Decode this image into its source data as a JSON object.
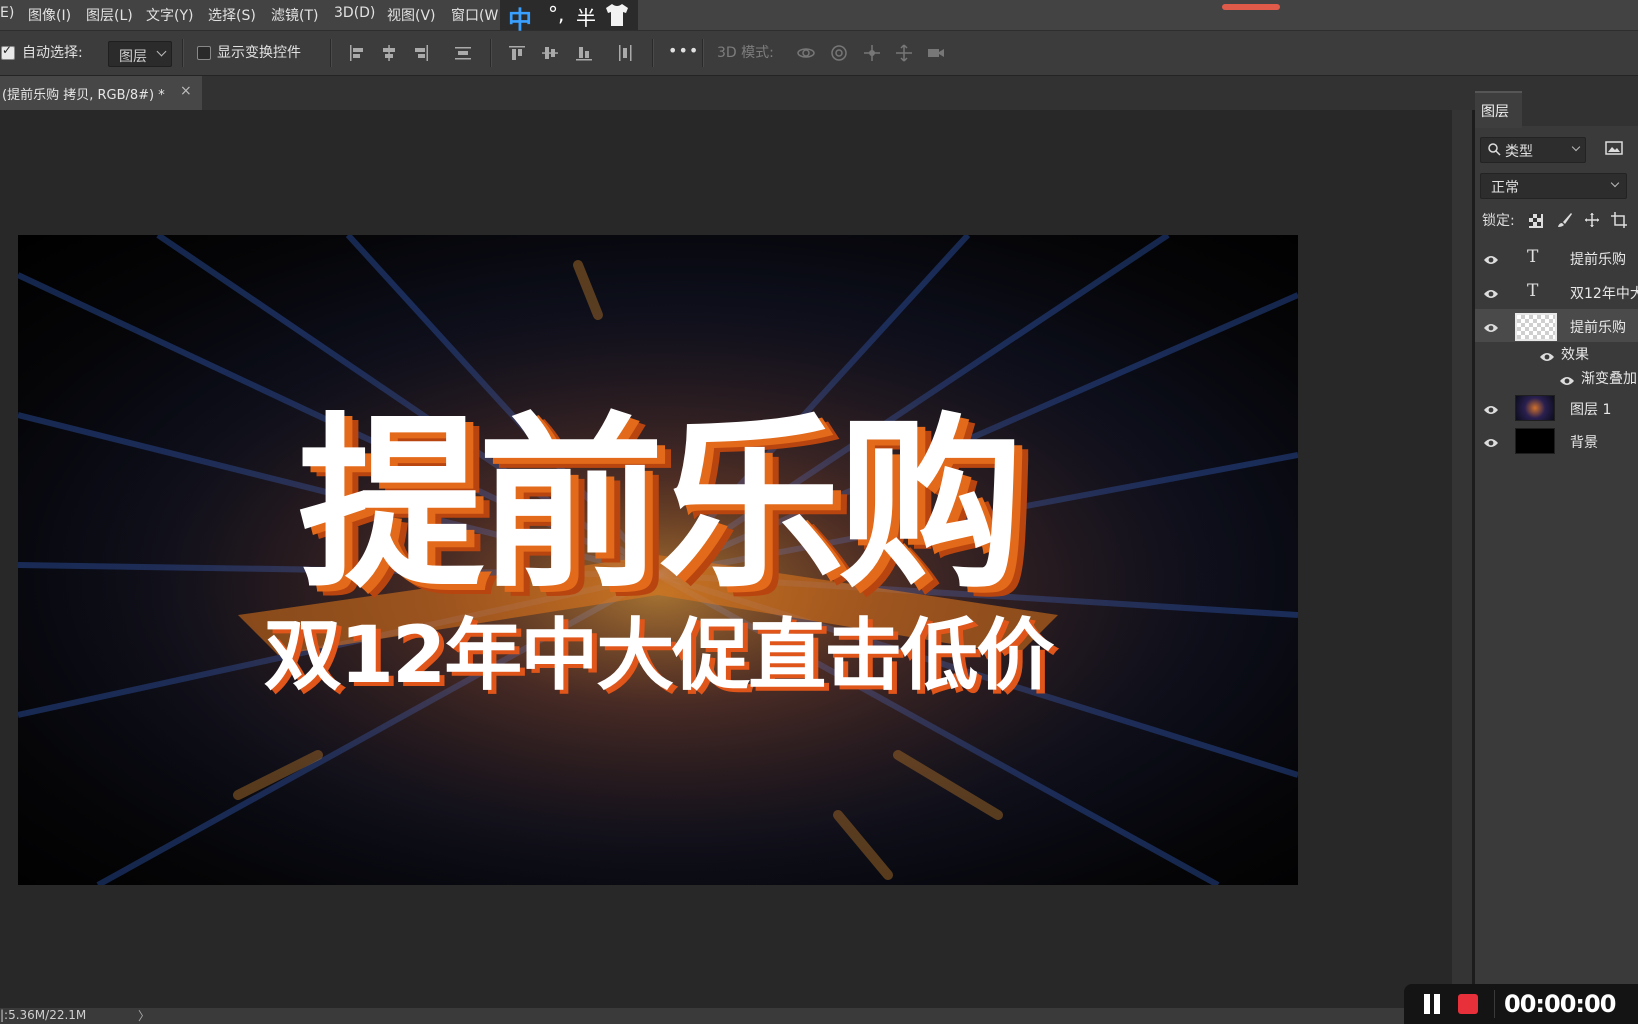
{
  "menu": {
    "items": [
      "E)",
      "图像(I)",
      "图层(L)",
      "文字(Y)",
      "选择(S)",
      "滤镜(T)",
      "3D(D)",
      "视图(V)",
      "窗口(W"
    ]
  },
  "ime": {
    "mode": "中",
    "punct": "°,",
    "width": "半",
    "skin_icon": "tshirt-icon"
  },
  "options": {
    "auto_select_label": "自动选择:",
    "auto_select_checked": true,
    "target_value": "图层",
    "show_transform_label": "显示变换控件",
    "show_transform_checked": false,
    "more_label": "•••",
    "mode_3d_label": "3D 模式:"
  },
  "document": {
    "tab_title": "(提前乐购 拷贝, RGB/8#) *",
    "close_glyph": "×"
  },
  "artwork": {
    "headline": "提前乐购",
    "subline": "双12年中大促直击低价",
    "accent": "#e26a1a"
  },
  "layers_panel": {
    "tab_label": "图层",
    "filter_value": "类型",
    "blend_mode": "正常",
    "lock_label": "锁定:",
    "layers": [
      {
        "kind": "text",
        "name": "提前乐购"
      },
      {
        "kind": "text",
        "name": "双12年中大"
      },
      {
        "kind": "raster",
        "name": "提前乐购",
        "selected": true
      },
      {
        "kind": "effects",
        "name": "效果"
      },
      {
        "kind": "effect",
        "name": "渐变叠加"
      },
      {
        "kind": "image",
        "name": "图层 1"
      },
      {
        "kind": "fill",
        "name": "背景"
      }
    ]
  },
  "status": {
    "doc_size": "|:5.36M/22.1M",
    "arrow": "〉"
  },
  "recorder": {
    "time": "00:00:00",
    "stop_color": "#e8303a"
  }
}
